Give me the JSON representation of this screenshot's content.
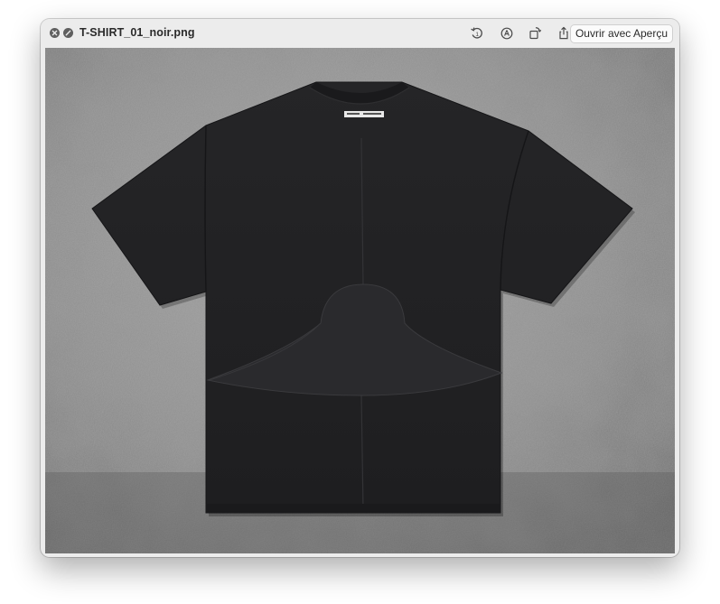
{
  "window": {
    "title": "T-SHIRT_01_noir.png"
  },
  "toolbar": {
    "close_icon": "close-circle-icon",
    "fullscreen_icon": "slash-circle-icon",
    "rotate_icon": "rotate-left-icon",
    "markup_icon": "markup-pen-icon",
    "crop_icon": "rotate-crop-icon",
    "share_icon": "share-icon",
    "open_button_label": "Ouvrir avec Aperçu"
  },
  "image": {
    "subject": "black-tshirt-photo",
    "label_text": "1017 ALYX 9SM",
    "colors": {
      "shirt": "#222224",
      "concrete": "#8f8f8f"
    }
  }
}
